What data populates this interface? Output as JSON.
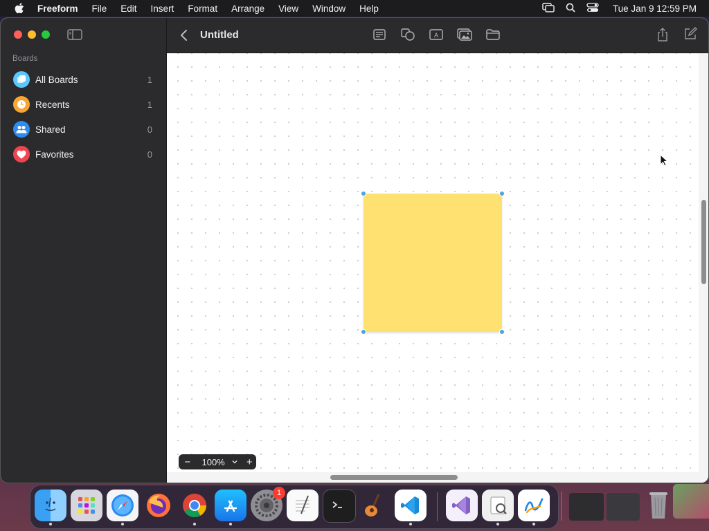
{
  "menubar": {
    "app_name": "Freeform",
    "menus": [
      "File",
      "Edit",
      "Insert",
      "Format",
      "Arrange",
      "View",
      "Window",
      "Help"
    ],
    "clock": "Tue Jan 9  12:59 PM",
    "status_icons": [
      "screen-mirroring-icon",
      "spotlight-search-icon",
      "control-center-icon"
    ]
  },
  "sidebar": {
    "heading": "Boards",
    "items": [
      {
        "label": "All Boards",
        "count": "1",
        "icon": "boards-icon",
        "color": "#5ac8fa"
      },
      {
        "label": "Recents",
        "count": "1",
        "icon": "clock-icon",
        "color": "#f7a731"
      },
      {
        "label": "Shared",
        "count": "0",
        "icon": "people-icon",
        "color": "#2f8cf0"
      },
      {
        "label": "Favorites",
        "count": "0",
        "icon": "heart-icon",
        "color": "#ef4550"
      }
    ]
  },
  "toolbar": {
    "title": "Untitled",
    "tools": [
      "sticky-note-icon",
      "shapes-icon",
      "text-box-icon",
      "media-icon",
      "folder-icon"
    ],
    "right": [
      "share-icon",
      "compose-icon"
    ]
  },
  "canvas": {
    "sticky_note": {
      "color": "#ffe171",
      "text": ""
    },
    "zoom": {
      "value": "100%",
      "minus": "−",
      "plus": "+"
    }
  },
  "dock": {
    "apps": [
      {
        "name": "Finder",
        "icon": "finder-icon",
        "running": true
      },
      {
        "name": "Launchpad",
        "icon": "launchpad-icon",
        "running": false
      },
      {
        "name": "Safari",
        "icon": "safari-icon",
        "running": true
      },
      {
        "name": "Firefox",
        "icon": "firefox-icon",
        "running": false
      },
      {
        "name": "Chrome",
        "icon": "chrome-icon",
        "running": true
      },
      {
        "name": "App Store",
        "icon": "app-store-icon",
        "running": true
      },
      {
        "name": "System Settings",
        "icon": "settings-icon",
        "running": false,
        "badge": "1"
      },
      {
        "name": "TextEdit",
        "icon": "textedit-icon",
        "running": false
      },
      {
        "name": "Terminal",
        "icon": "terminal-icon",
        "running": false
      },
      {
        "name": "GarageBand",
        "icon": "guitar-icon",
        "running": false
      },
      {
        "name": "VS Code",
        "icon": "vscode-icon",
        "running": true
      },
      {
        "name": "Visual Studio",
        "icon": "visual-studio-icon",
        "running": false
      },
      {
        "name": "Preview",
        "icon": "preview-icon",
        "running": true
      },
      {
        "name": "Freeform",
        "icon": "freeform-icon",
        "running": true
      },
      {
        "name": "Window 1",
        "icon": "window-thumbnail-icon",
        "running": false
      },
      {
        "name": "Window 2",
        "icon": "window-thumbnail-icon",
        "running": false
      },
      {
        "name": "Trash",
        "icon": "trash-icon",
        "running": false
      }
    ]
  }
}
